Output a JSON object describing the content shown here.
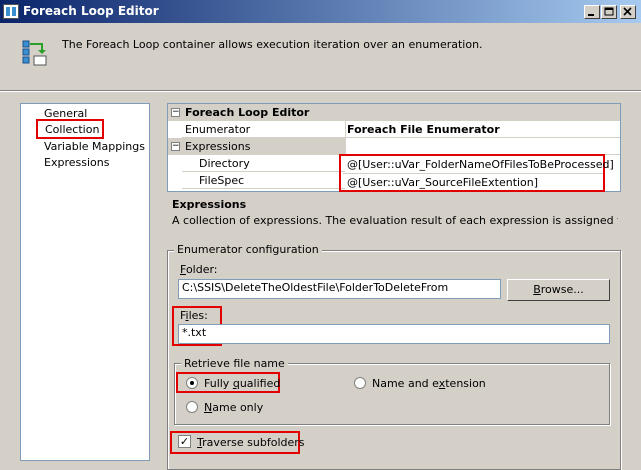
{
  "window": {
    "title": "Foreach Loop Editor"
  },
  "header": {
    "description": "The Foreach Loop container allows execution iteration over an enumeration."
  },
  "nav": {
    "items": [
      "General",
      "Collection",
      "Variable Mappings",
      "Expressions"
    ],
    "selected": "Collection"
  },
  "grid": {
    "section_title": "Foreach Loop Editor",
    "enumerator_label": "Enumerator",
    "enumerator_value": "Foreach File Enumerator",
    "expressions_label": "Expressions",
    "directory_label": "Directory",
    "directory_value": "@[User::uVar_FolderNameOfFilesToBeProcessed]",
    "filespec_label": "FileSpec",
    "filespec_value": "@[User::uVar_SourceFileExtention]"
  },
  "description_pane": {
    "title": "Expressions",
    "text": "A collection of expressions. The evaluation result of each expression is assigned to a prop..."
  },
  "config": {
    "group_label": "Enumerator configuration",
    "folder_label": "Folder:",
    "folder_value": "C:\\SSIS\\DeleteTheOldestFile\\FolderToDeleteFrom",
    "browse_label": "Browse...",
    "files_label": "Files:",
    "files_value": "*.txt",
    "retrieve_label": "Retrieve file name",
    "opt_fully_qualified": "Fully qualified",
    "opt_name_extension": "Name and extension",
    "opt_name_only": "Name only",
    "selected_option": "Fully qualified",
    "traverse_label": "Traverse subfolders",
    "traverse_checked": true
  },
  "colors": {
    "highlight": "#e30000",
    "titlebar_start": "#0a246a",
    "titlebar_end": "#a6caf0"
  }
}
